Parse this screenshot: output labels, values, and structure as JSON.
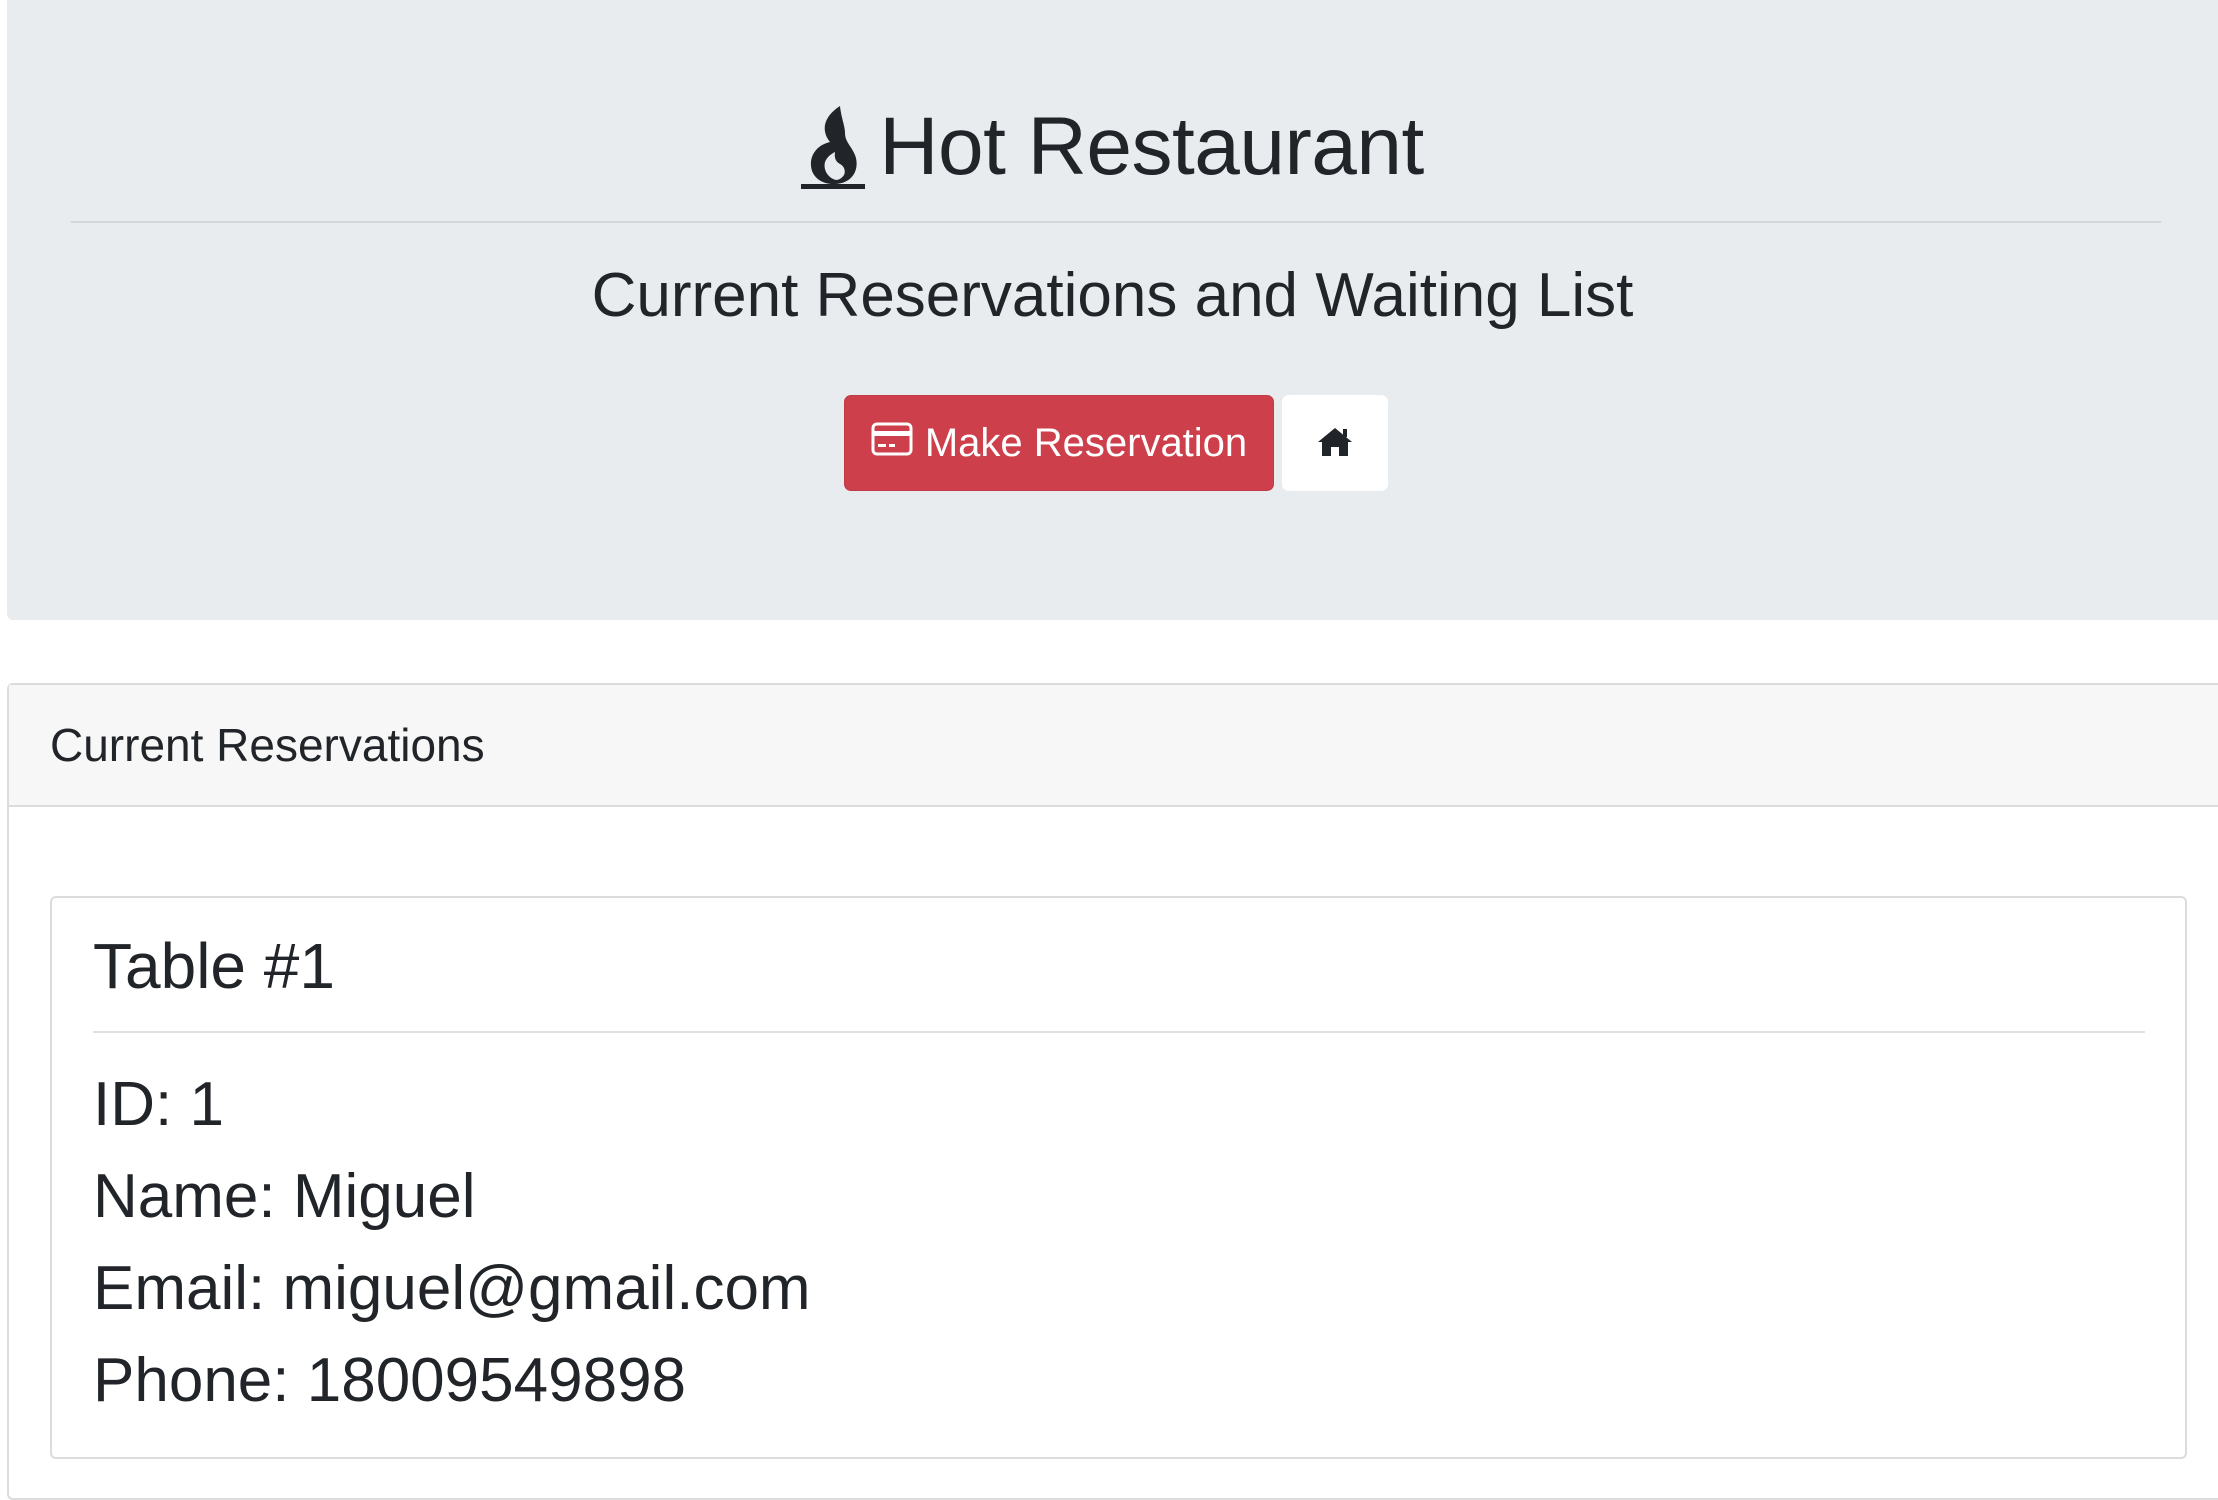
{
  "header": {
    "brand_icon": "fire-icon",
    "brand_title": "Hot Restaurant",
    "subtitle": "Current Reservations and Waiting List",
    "reserve_button_icon": "credit-card-icon",
    "reserve_button_label": "Make Reservation",
    "home_button_icon": "home-icon"
  },
  "reservations": {
    "section_title": "Current Reservations",
    "items": [
      {
        "table_title": "Table #1",
        "id_text": "ID: 1",
        "name_text": "Name: Miguel",
        "email_text": "Email: miguel@gmail.com",
        "phone_text": "Phone: 18009549898"
      }
    ]
  },
  "colors": {
    "jumbotron_bg": "#e9ecef",
    "danger": "#cc3f4b",
    "text": "#212529"
  }
}
